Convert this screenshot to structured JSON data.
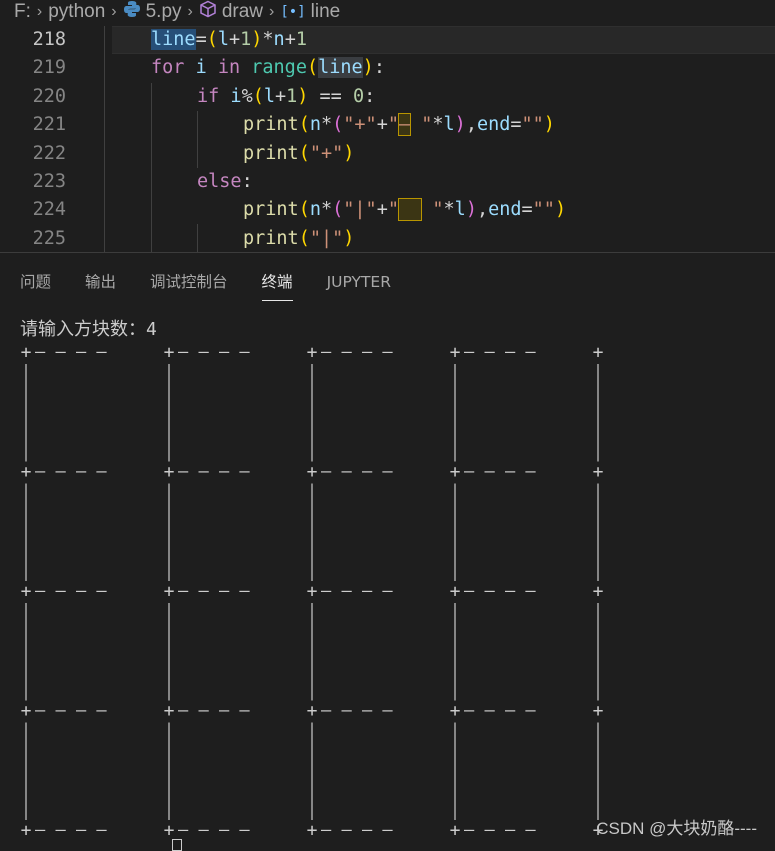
{
  "breadcrumb": {
    "drive": "F:",
    "folder": "python",
    "file": "5.py",
    "symbol": "draw",
    "variable": "line",
    "separator": ">"
  },
  "editor": {
    "line_numbers": [
      "218",
      "219",
      "220",
      "221",
      "222",
      "223",
      "224",
      "225"
    ],
    "active_line": "218"
  },
  "panel": {
    "tabs": [
      "问题",
      "输出",
      "调试控制台",
      "终端",
      "JUPYTER"
    ],
    "active_tab": "终端"
  },
  "terminal": {
    "prompt": "请输入方块数：",
    "input_value": "4",
    "grid_size": 4,
    "horizontal_segment": "— — — —",
    "corner": "+",
    "vertical": "|"
  },
  "watermark": "CSDN @大块奶酪----",
  "colors": {
    "background": "#1e1e1e",
    "keyword": "#c586c0",
    "builtin_keyword": "#569cd6",
    "variable": "#9cdcfe",
    "function": "#dcdcaa",
    "string": "#ce9178",
    "number": "#b5cea8",
    "class": "#4ec9b0"
  }
}
